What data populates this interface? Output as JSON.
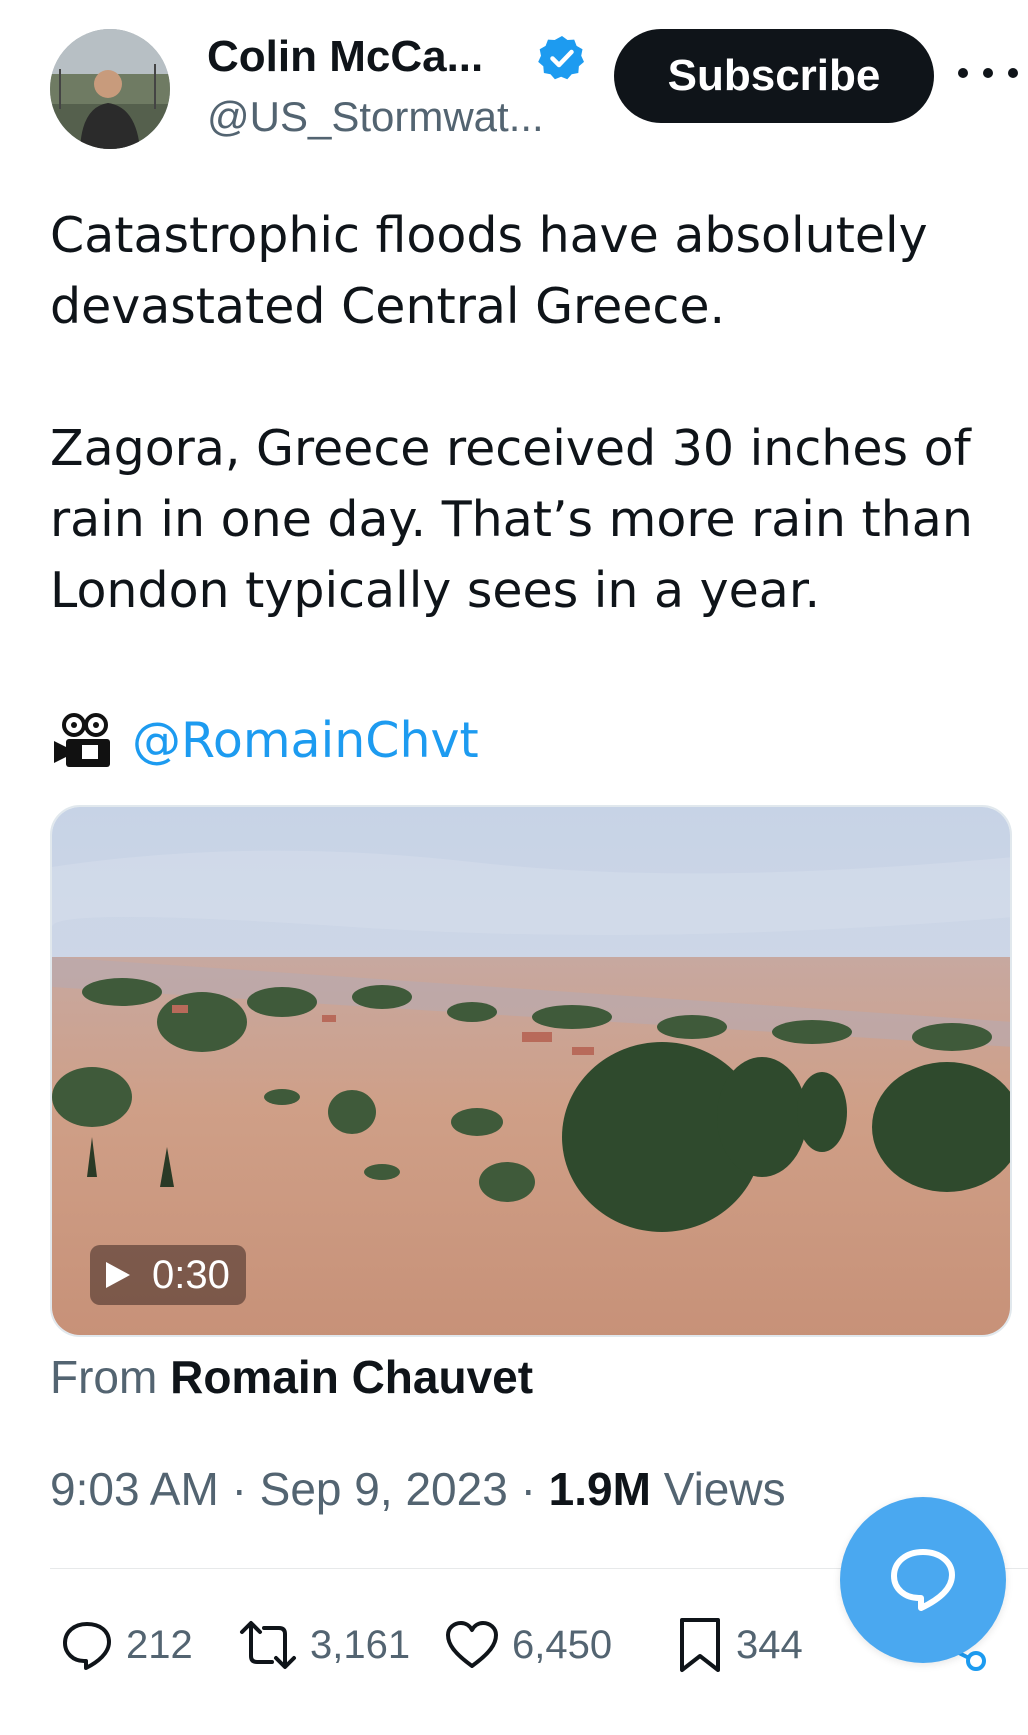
{
  "author": {
    "display_name": "Colin McCa...",
    "handle": "@US_Stormwat...",
    "avatar_icon": "profile-photo",
    "verified_icon": "verified-badge-icon"
  },
  "header": {
    "subscribe_label": "Subscribe",
    "more_icon": "more-options-icon"
  },
  "tweet": {
    "line1": "Catastrophic floods have absolutely",
    "line2": "devastated Central Greece.",
    "line3": "Zagora, Greece received 30 inches of",
    "line4": "rain in one day. That’s more rain than",
    "line5": "London typically sees in a year.",
    "credit_emoji": "🎥",
    "credit_handle": "@RomainChvt"
  },
  "media": {
    "duration": "0:30",
    "from_prefix": "From",
    "from_name": "Romain Chauvet"
  },
  "meta": {
    "time": "9:03 AM",
    "separator": "·",
    "date": "Sep 9, 2023",
    "views_count": "1.9M",
    "views_label": "Views"
  },
  "actions": {
    "replies": "212",
    "reposts": "3,161",
    "likes": "6,450",
    "bookmarks": "344"
  },
  "colors": {
    "accent": "#1d9bf0",
    "fab": "#4aa8f0",
    "text": "#0f1419",
    "secondary": "#536471"
  }
}
